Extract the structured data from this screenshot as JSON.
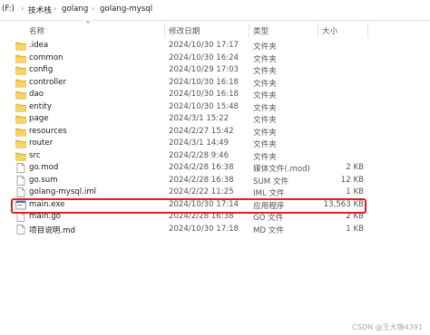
{
  "breadcrumb": [
    "(F:)",
    "技术栈",
    "golang",
    "golang-mysql"
  ],
  "columns": {
    "name": "名称",
    "date": "修改日期",
    "type": "类型",
    "size": "大小"
  },
  "files": [
    {
      "icon": "folder-icon",
      "name": ".idea",
      "date": "2024/10/30 17:17",
      "type": "文件夹",
      "size": ""
    },
    {
      "icon": "folder-icon",
      "name": "common",
      "date": "2024/10/30 16:24",
      "type": "文件夹",
      "size": ""
    },
    {
      "icon": "folder-icon",
      "name": "config",
      "date": "2024/10/29 17:03",
      "type": "文件夹",
      "size": ""
    },
    {
      "icon": "folder-icon",
      "name": "controller",
      "date": "2024/10/30 16:18",
      "type": "文件夹",
      "size": ""
    },
    {
      "icon": "folder-icon",
      "name": "dao",
      "date": "2024/10/30 16:18",
      "type": "文件夹",
      "size": ""
    },
    {
      "icon": "folder-icon",
      "name": "entity",
      "date": "2024/10/30 15:48",
      "type": "文件夹",
      "size": ""
    },
    {
      "icon": "folder-icon",
      "name": "page",
      "date": "2024/3/1 15:22",
      "type": "文件夹",
      "size": ""
    },
    {
      "icon": "folder-icon",
      "name": "resources",
      "date": "2024/2/27 15:42",
      "type": "文件夹",
      "size": ""
    },
    {
      "icon": "folder-icon",
      "name": "router",
      "date": "2024/3/1 14:49",
      "type": "文件夹",
      "size": ""
    },
    {
      "icon": "folder-icon",
      "name": "src",
      "date": "2024/2/28 9:46",
      "type": "文件夹",
      "size": ""
    },
    {
      "icon": "file-icon",
      "name": "go.mod",
      "date": "2024/2/28 16:38",
      "type": "媒体文件(.mod)",
      "size": "2 KB"
    },
    {
      "icon": "file-icon",
      "name": "go.sum",
      "date": "2024/2/28 16:38",
      "type": "SUM 文件",
      "size": "12 KB"
    },
    {
      "icon": "file-icon",
      "name": "golang-mysql.iml",
      "date": "2024/2/22 11:25",
      "type": "IML 文件",
      "size": "1 KB"
    },
    {
      "icon": "exe-icon",
      "name": "main.exe",
      "date": "2024/10/30 17:14",
      "type": "应用程序",
      "size": "13,563 KB"
    },
    {
      "icon": "file-icon",
      "name": "main.go",
      "date": "2024/2/28 16:38",
      "type": "GO 文件",
      "size": "2 KB"
    },
    {
      "icon": "file-icon",
      "name": "项目说明.md",
      "date": "2024/10/30 17:18",
      "type": "MD 文件",
      "size": "1 KB"
    }
  ],
  "highlighted_file": "main.exe",
  "watermark": "CSDN @王大锤4391",
  "colors": {
    "highlight_border": "#e02020",
    "folder": "#f0c040",
    "header_text": "#4a5a70"
  }
}
